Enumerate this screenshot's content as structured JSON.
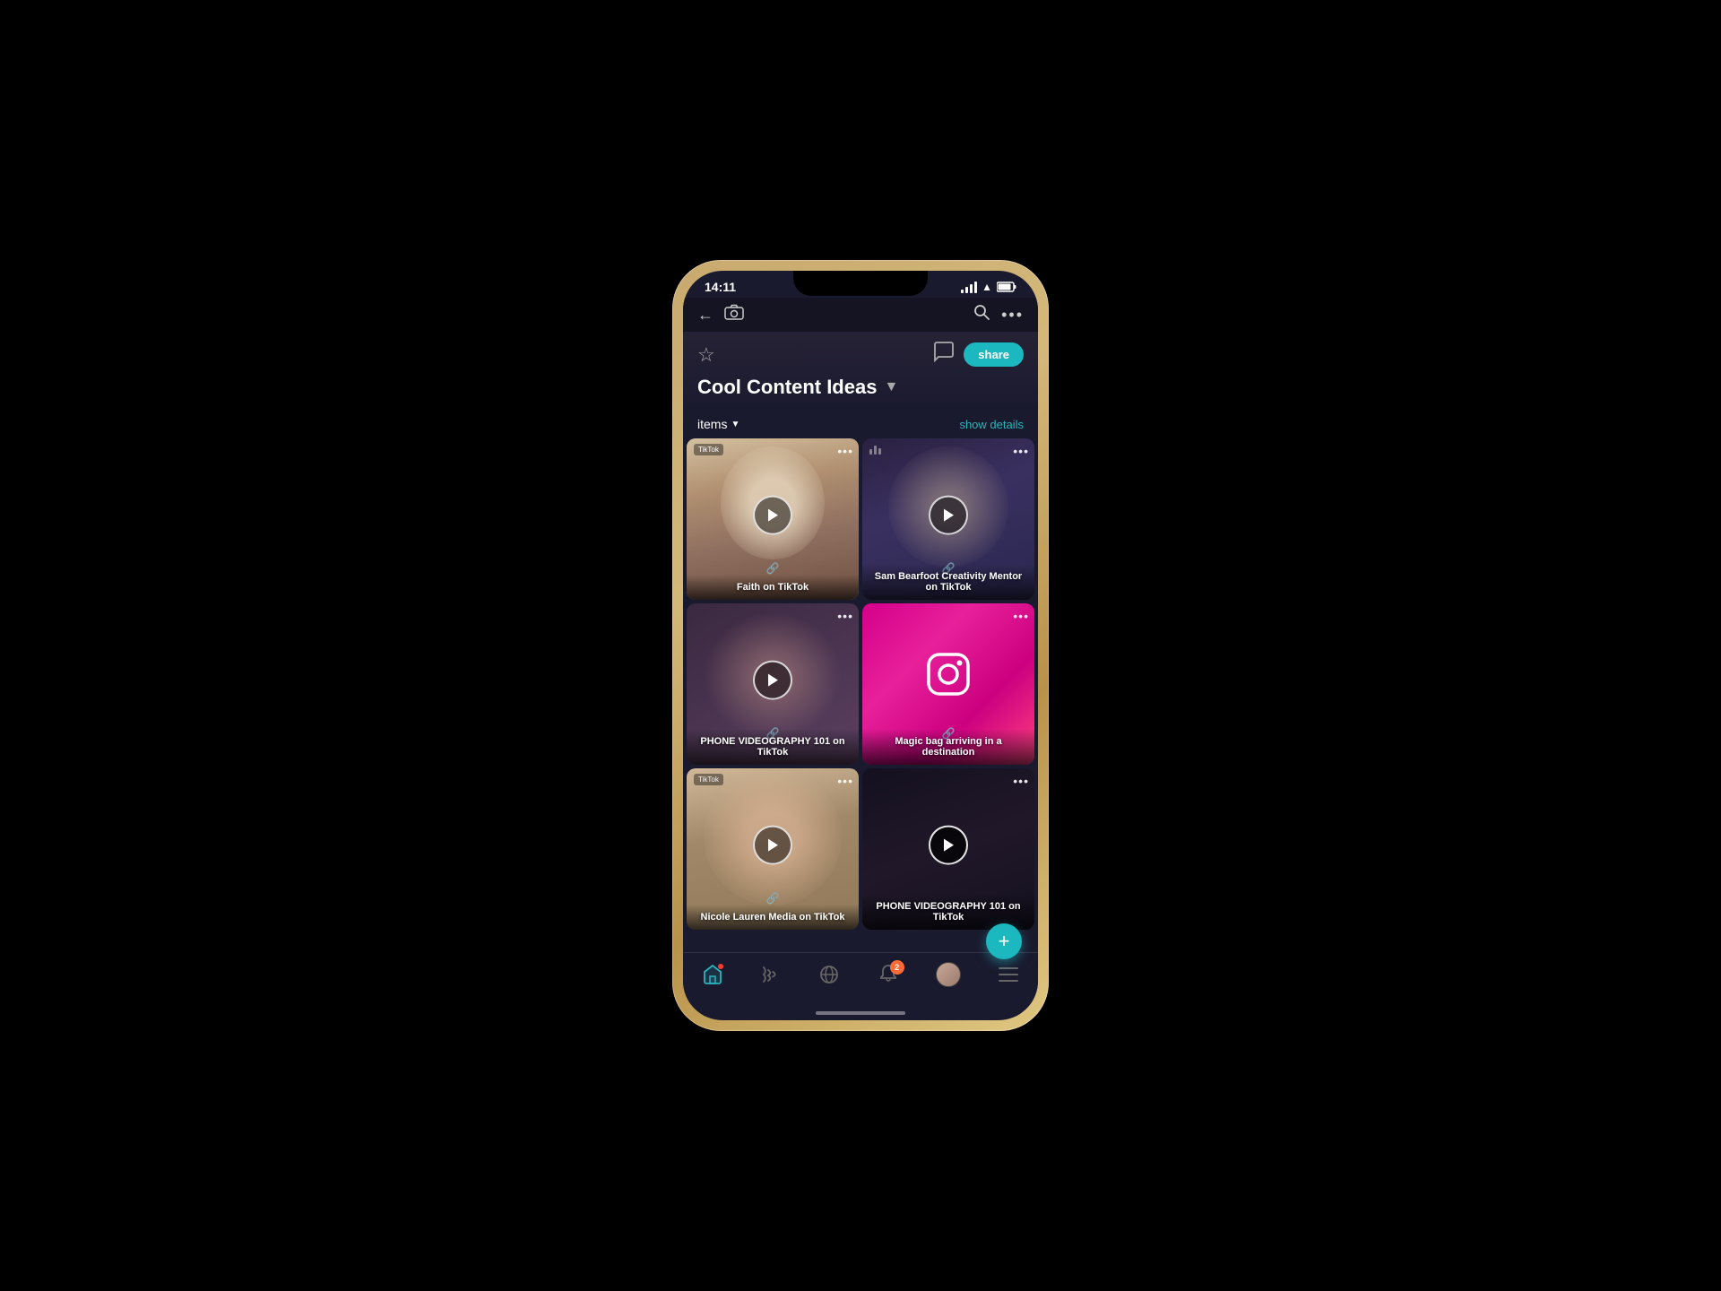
{
  "phone": {
    "status": {
      "time": "14:11",
      "signal": true,
      "wifi": true,
      "battery": true
    }
  },
  "header": {
    "back_icon": "←",
    "camera_icon": "📷",
    "search_icon": "🔍",
    "more_icon": "···",
    "star_icon": "☆",
    "chat_icon": "💬",
    "share_label": "share",
    "page_title": "Cool Content Ideas",
    "chevron": "▼"
  },
  "toolbar": {
    "items_label": "items",
    "items_arrow": "▼",
    "show_details_label": "show details"
  },
  "grid": {
    "cards": [
      {
        "id": "faith",
        "title": "Faith on TikTok",
        "bg_class": "card-faith"
      },
      {
        "id": "sam",
        "title": "Sam Bearfoot Creativity Mentor on TikTok",
        "bg_class": "card-sam"
      },
      {
        "id": "phone-video",
        "title": "PHONE VIDEOGRAPHY 101 on TikTok",
        "bg_class": "card-phone"
      },
      {
        "id": "magic",
        "title": "Magic bag arriving in a destination",
        "bg_class": "card-magic"
      },
      {
        "id": "nicole",
        "title": "Nicole Lauren Media on TikTok",
        "bg_class": "card-nicole"
      },
      {
        "id": "phone-video2",
        "title": "PHONE VIDEOGRAPHY 101 on TikTok",
        "bg_class": "card-phone2"
      }
    ],
    "three_dots": "•••"
  },
  "bottom_nav": {
    "items": [
      {
        "id": "home",
        "icon": "⌂",
        "active": true,
        "label": "home"
      },
      {
        "id": "feed",
        "icon": "◉",
        "active": false,
        "label": "feed"
      },
      {
        "id": "globe",
        "icon": "🌐",
        "active": false,
        "label": "globe"
      },
      {
        "id": "bell",
        "icon": "🔔",
        "active": false,
        "badge": "2",
        "label": "notifications"
      },
      {
        "id": "avatar",
        "active": false,
        "label": "profile"
      },
      {
        "id": "menu",
        "icon": "☰",
        "active": false,
        "label": "menu"
      }
    ]
  },
  "fab": {
    "icon": "+",
    "label": "add"
  }
}
